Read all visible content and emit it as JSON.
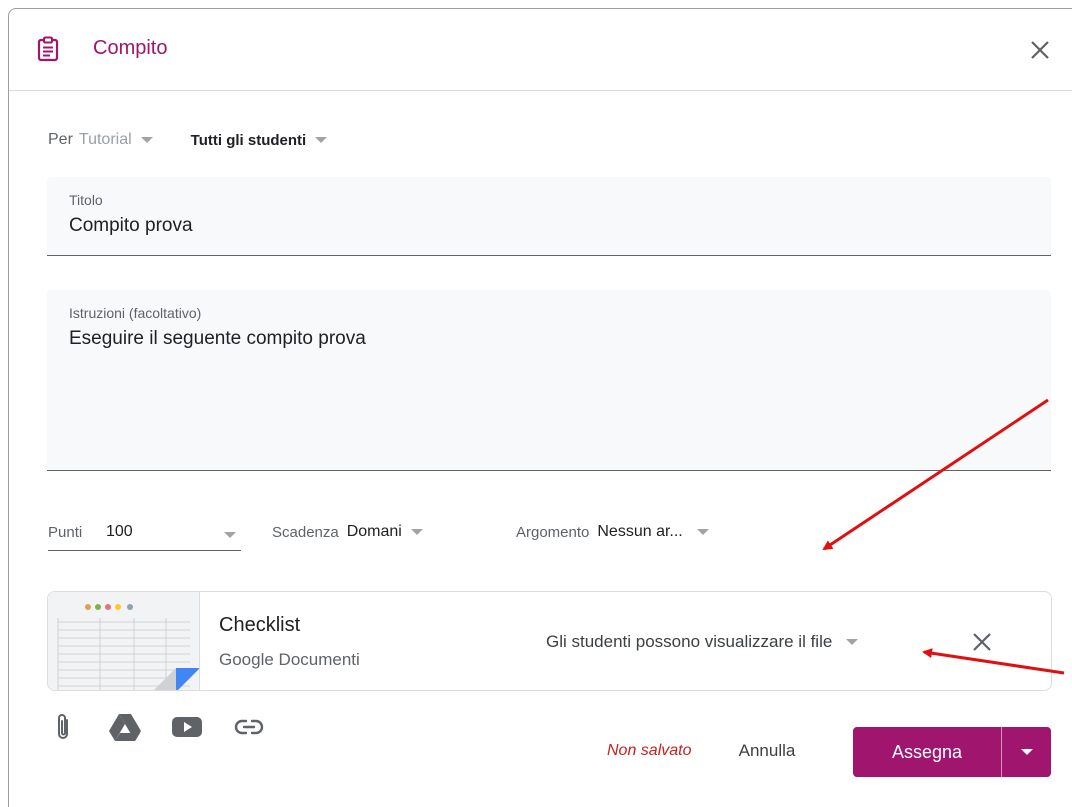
{
  "dialog": {
    "title": "Compito",
    "accent_color": "#a0156e"
  },
  "audience": {
    "for_label": "Per",
    "class_value": "Tutorial",
    "students_value": "Tutti gli studenti"
  },
  "title_field": {
    "label": "Titolo",
    "value": "Compito prova"
  },
  "instructions_field": {
    "label": "Istruzioni (facoltativo)",
    "value": "Eseguire il seguente compito prova"
  },
  "meta": {
    "points_label": "Punti",
    "points_value": "100",
    "due_label": "Scadenza",
    "due_value": "Domani",
    "topic_label": "Argomento",
    "topic_value": "Nessun ar..."
  },
  "attachment": {
    "name": "Checklist",
    "type": "Google Documenti",
    "permission": "Gli studenti possono visualizzare il file"
  },
  "footer": {
    "icons": [
      "paperclip-icon",
      "google-drive-icon",
      "youtube-icon",
      "link-icon"
    ],
    "status": "Non salvato",
    "status_color": "#c5221f",
    "cancel_label": "Annulla",
    "assign_label": "Assegna"
  }
}
